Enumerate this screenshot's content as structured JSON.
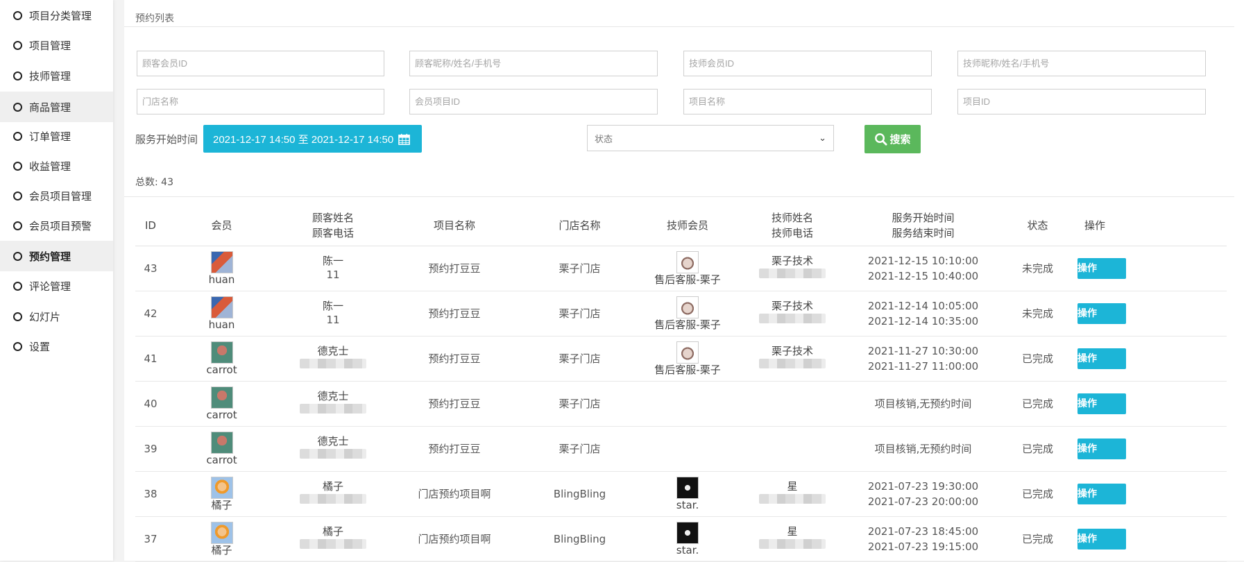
{
  "sidebar": {
    "items": [
      {
        "label": "项目分类管理"
      },
      {
        "label": "项目管理"
      },
      {
        "label": "技师管理"
      },
      {
        "label": "商品管理"
      },
      {
        "label": "订单管理"
      },
      {
        "label": "收益管理"
      },
      {
        "label": "会员项目管理"
      },
      {
        "label": "会员项目预警"
      },
      {
        "label": "预约管理"
      },
      {
        "label": "评论管理"
      },
      {
        "label": "幻灯片"
      },
      {
        "label": "设置"
      }
    ]
  },
  "page": {
    "title": "预约列表"
  },
  "filters": {
    "customer_id": "顾客会员ID",
    "customer_name": "顾客昵称/姓名/手机号",
    "tech_id": "技师会员ID",
    "tech_name": "技师昵称/姓名/手机号",
    "store_name": "门店名称",
    "member_project_id": "会员项目ID",
    "project_name": "项目名称",
    "project_id": "项目ID",
    "date_label": "服务开始时间",
    "date_range": "2021-12-17 14:50 至 2021-12-17 14:50",
    "status_placeholder": "状态",
    "search_label": "搜索"
  },
  "summary": {
    "total_label": "总数:",
    "total": "43"
  },
  "table": {
    "headers": {
      "id": "ID",
      "member": "会员",
      "customer_name": "顾客姓名",
      "customer_phone": "顾客电话",
      "project": "项目名称",
      "store": "门店名称",
      "tech_member": "技师会员",
      "tech_name": "技师姓名",
      "tech_phone": "技师电话",
      "start": "服务开始时间",
      "end": "服务结束时间",
      "status": "状态",
      "ops": "操作"
    },
    "rows": [
      {
        "id": "43",
        "member": "huan",
        "avatar": "av-huan",
        "customer": "陈一",
        "phone": "11",
        "project": "预约打豆豆",
        "store": "栗子门店",
        "tech_member": "售后客服-栗子",
        "tech_avatar": "av-bear",
        "tech_name": "栗子技术",
        "start": "2021-12-15 10:10:00",
        "end": "2021-12-15 10:40:00",
        "note": "",
        "status": "未完成",
        "op": "操作"
      },
      {
        "id": "42",
        "member": "huan",
        "avatar": "av-huan",
        "customer": "陈一",
        "phone": "11",
        "project": "预约打豆豆",
        "store": "栗子门店",
        "tech_member": "售后客服-栗子",
        "tech_avatar": "av-bear",
        "tech_name": "栗子技术",
        "start": "2021-12-14 10:05:00",
        "end": "2021-12-14 10:35:00",
        "note": "",
        "status": "未完成",
        "op": "操作"
      },
      {
        "id": "41",
        "member": "carrot",
        "avatar": "av-carrot",
        "customer": "德克士",
        "phone": "",
        "project": "预约打豆豆",
        "store": "栗子门店",
        "tech_member": "售后客服-栗子",
        "tech_avatar": "av-bear",
        "tech_name": "栗子技术",
        "start": "2021-11-27 10:30:00",
        "end": "2021-11-27 11:00:00",
        "note": "",
        "status": "已完成",
        "op": "操作"
      },
      {
        "id": "40",
        "member": "carrot",
        "avatar": "av-carrot",
        "customer": "德克士",
        "phone": "",
        "project": "预约打豆豆",
        "store": "栗子门店",
        "tech_member": "",
        "tech_avatar": "",
        "tech_name": "",
        "start": "",
        "end": "",
        "note": "项目核销,无预约时间",
        "status": "已完成",
        "op": "操作"
      },
      {
        "id": "39",
        "member": "carrot",
        "avatar": "av-carrot",
        "customer": "德克士",
        "phone": "",
        "project": "预约打豆豆",
        "store": "栗子门店",
        "tech_member": "",
        "tech_avatar": "",
        "tech_name": "",
        "start": "",
        "end": "",
        "note": "项目核销,无预约时间",
        "status": "已完成",
        "op": "操作"
      },
      {
        "id": "38",
        "member": "橘子",
        "avatar": "av-orange",
        "customer": "橘子",
        "phone": "",
        "project": "门店预约项目啊",
        "store": "BlingBling",
        "tech_member": "star.",
        "tech_avatar": "av-star",
        "tech_name": "星",
        "start": "2021-07-23 19:30:00",
        "end": "2021-07-23 20:00:00",
        "note": "",
        "status": "已完成",
        "op": "操作"
      },
      {
        "id": "37",
        "member": "橘子",
        "avatar": "av-orange",
        "customer": "橘子",
        "phone": "",
        "project": "门店预约项目啊",
        "store": "BlingBling",
        "tech_member": "star.",
        "tech_avatar": "av-star",
        "tech_name": "星",
        "start": "2021-07-23 18:45:00",
        "end": "2021-07-23 19:15:00",
        "note": "",
        "status": "已完成",
        "op": "操作"
      }
    ]
  },
  "colors": {
    "primary": "#1cb5d7",
    "success": "#5bb85c"
  }
}
